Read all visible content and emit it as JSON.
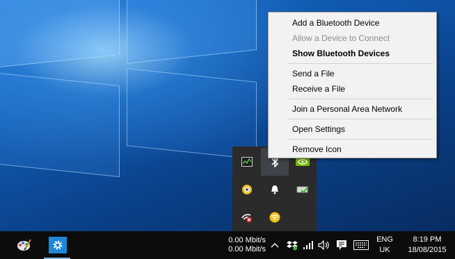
{
  "context_menu": {
    "items": [
      {
        "label": "Add a Bluetooth Device",
        "state": "normal"
      },
      {
        "label": "Allow a Device to Connect",
        "state": "disabled"
      },
      {
        "label": "Show Bluetooth Devices",
        "state": "default"
      },
      {
        "label": "Send a File",
        "state": "normal"
      },
      {
        "label": "Receive a File",
        "state": "normal"
      },
      {
        "label": "Join a Personal Area Network",
        "state": "normal"
      },
      {
        "label": "Open Settings",
        "state": "normal"
      },
      {
        "label": "Remove Icon",
        "state": "normal"
      }
    ]
  },
  "tray_overflow": {
    "icons": [
      "gpu-monitor-icon",
      "bluetooth-icon",
      "nvidia-icon",
      "media-disc-icon",
      "notification-bell-icon",
      "drive-check-icon",
      "network-error-icon",
      "wifi-hotspot-icon"
    ],
    "highlighted": "bluetooth-icon"
  },
  "taskbar": {
    "pinned": [
      "paint-tool-icon",
      "settings-gear-icon"
    ],
    "network_speed": {
      "up": "0.00 Mbit/s",
      "down": "0.00 Mbit/s"
    },
    "language": {
      "code": "ENG",
      "region": "UK"
    },
    "clock": {
      "time": "8:19 PM",
      "date": "18/08/2015"
    }
  },
  "colors": {
    "menu_bg": "#f2f2f2",
    "tray_bg": "#2b2b2b",
    "taskbar_bg": "#0c0c0c",
    "settings_accent": "#1e88d6",
    "nvidia_green": "#76b900"
  }
}
